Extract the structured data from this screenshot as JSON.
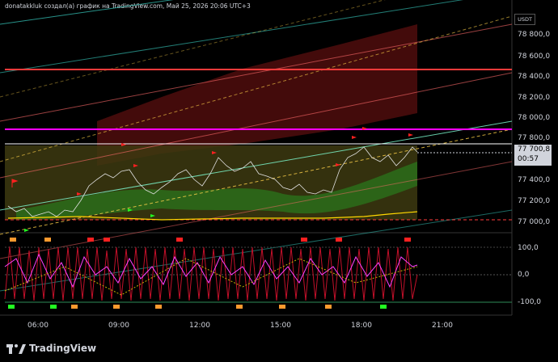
{
  "header": {
    "title": "donatakkluk создал(а) график на TradingView.com, Май 25, 2026 20:06 UTC+3"
  },
  "price_axis": {
    "currency": "USDT",
    "labels": [
      "78 800,0",
      "78 600,0",
      "78 400,0",
      "78 200,0",
      "78 000,0",
      "77 800,0",
      "77 400,0",
      "77 200,0",
      "77 000,0"
    ],
    "last_price": "77 700,8",
    "countdown": "00:57"
  },
  "oscillator_axis": {
    "labels": [
      "100,0",
      "0,0",
      "-100,0"
    ]
  },
  "time_axis": {
    "labels": [
      "06:00",
      "09:00",
      "12:00",
      "15:00",
      "18:00",
      "21:00"
    ]
  },
  "footer": {
    "brand": "TradingView"
  },
  "colors": {
    "background": "#000000",
    "price_line": "#ffffff",
    "magenta_level": "#ff00ff",
    "red_level": "#ff3b3b"
  }
}
